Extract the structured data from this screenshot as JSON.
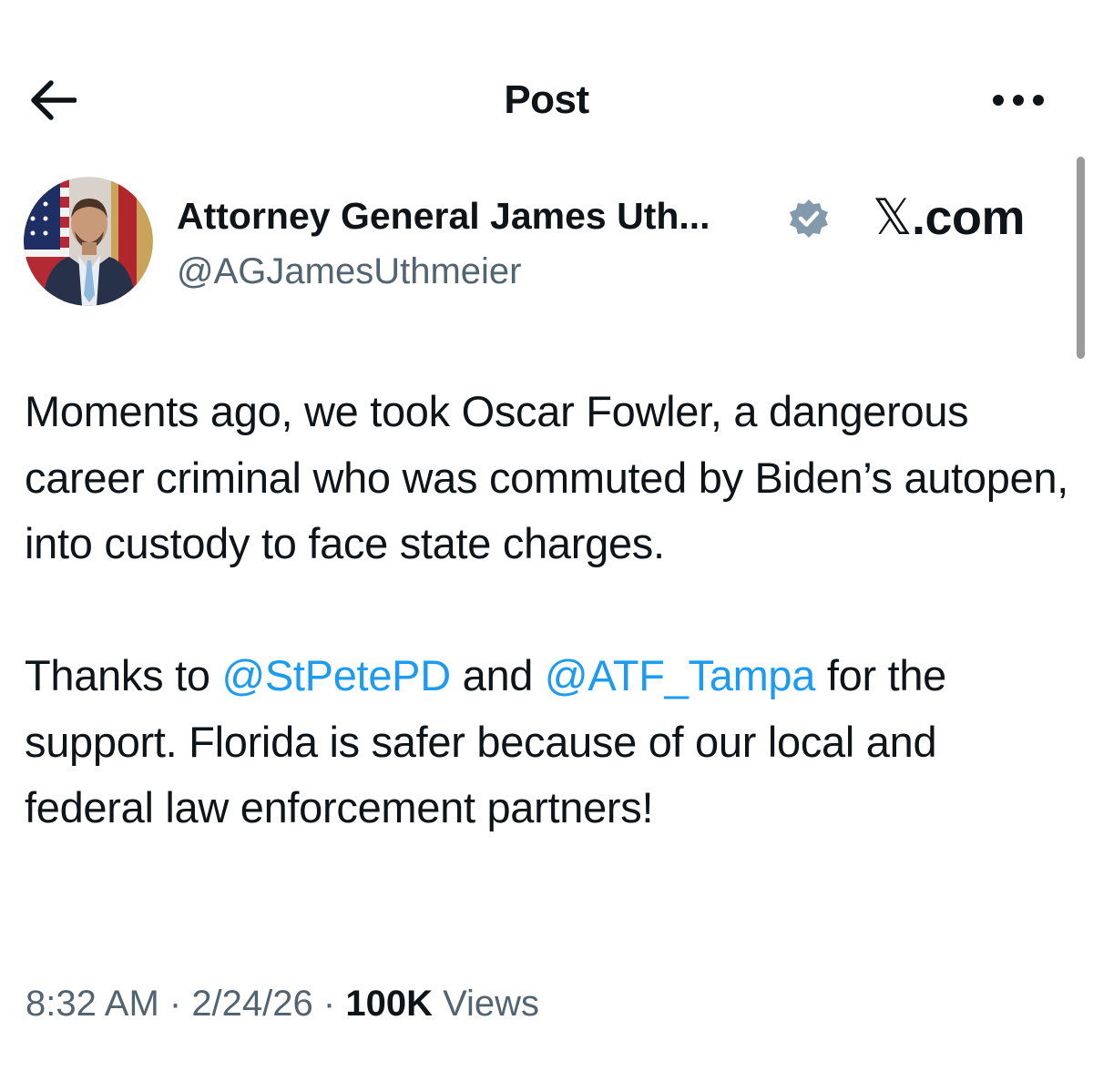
{
  "header": {
    "title": "Post",
    "back_icon": "arrow-left-icon",
    "more_icon": "more-horizontal-icon"
  },
  "author": {
    "name": "Attorney General James Uth...",
    "handle": "@AGJamesUthmeier",
    "verified": true,
    "verified_color": "#829aab",
    "avatar_icon": "profile-photo"
  },
  "source": {
    "glyph": "𝕏",
    "suffix": ".com"
  },
  "post": {
    "paragraph1": "Moments ago, we took Oscar Fowler, a dangerous career criminal who was commuted by Biden’s autopen, into custody to face state charges.",
    "p2_before": "Thanks to ",
    "mention1": "@StPetePD",
    "p2_mid": " and ",
    "mention2": "@ATF_Tampa",
    "p2_after": " for the support. Florida is safer because of our local and federal law enforcement partners!"
  },
  "meta": {
    "time": "8:32 AM",
    "date": "2/24/26",
    "separator": " · ",
    "view_count": "100K",
    "views_label": " Views"
  },
  "colors": {
    "text": "#0f1419",
    "secondary": "#536471",
    "link": "#1d9bf0",
    "background": "#ffffff"
  }
}
